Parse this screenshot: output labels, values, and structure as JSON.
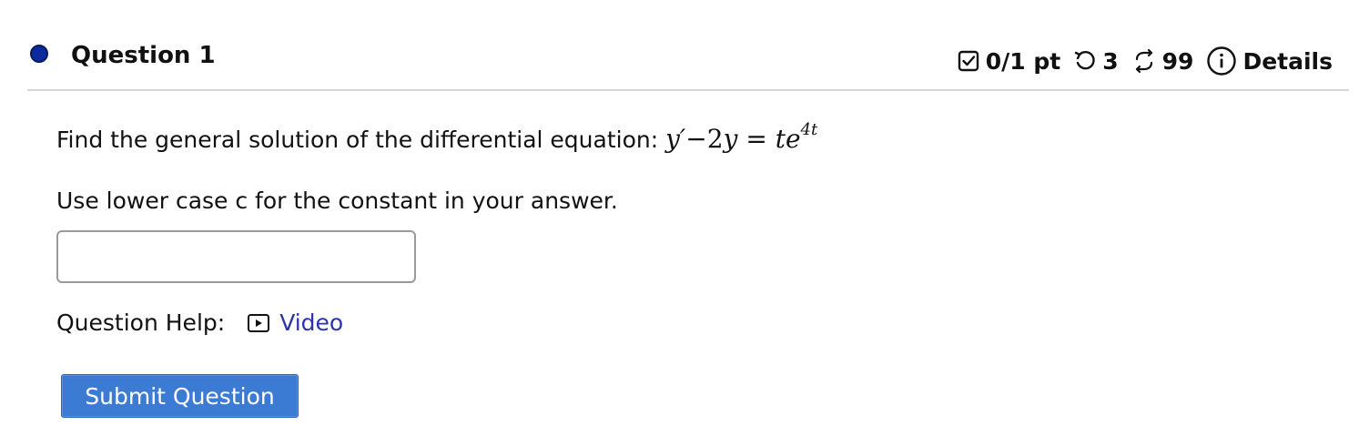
{
  "question": {
    "title": "Question 1",
    "status_color": "#0a2a9e",
    "score": "0/1 pt",
    "retries": "3",
    "attempts": "99",
    "details_label": "Details",
    "icons": [
      "checkbox-icon",
      "retry-icon",
      "attempts-icon",
      "info-icon"
    ]
  },
  "body": {
    "prompt_text": "Find the general solution of the differential equation: ",
    "equation": {
      "lhs_y": "y",
      "prime": "′",
      "minus": "−",
      "coef": "2",
      "y2": "y",
      "eq": "=",
      "rhs": "te",
      "exponent": "4t"
    },
    "hint": "Use lower case c for the constant in your answer.",
    "answer_value": "",
    "help_label": "Question Help:",
    "video_label": "Video",
    "submit_label": "Submit Question"
  },
  "colors": {
    "link": "#2b35a8",
    "submit_bg": "#3b7bd4",
    "divider": "#d6d6d6"
  }
}
